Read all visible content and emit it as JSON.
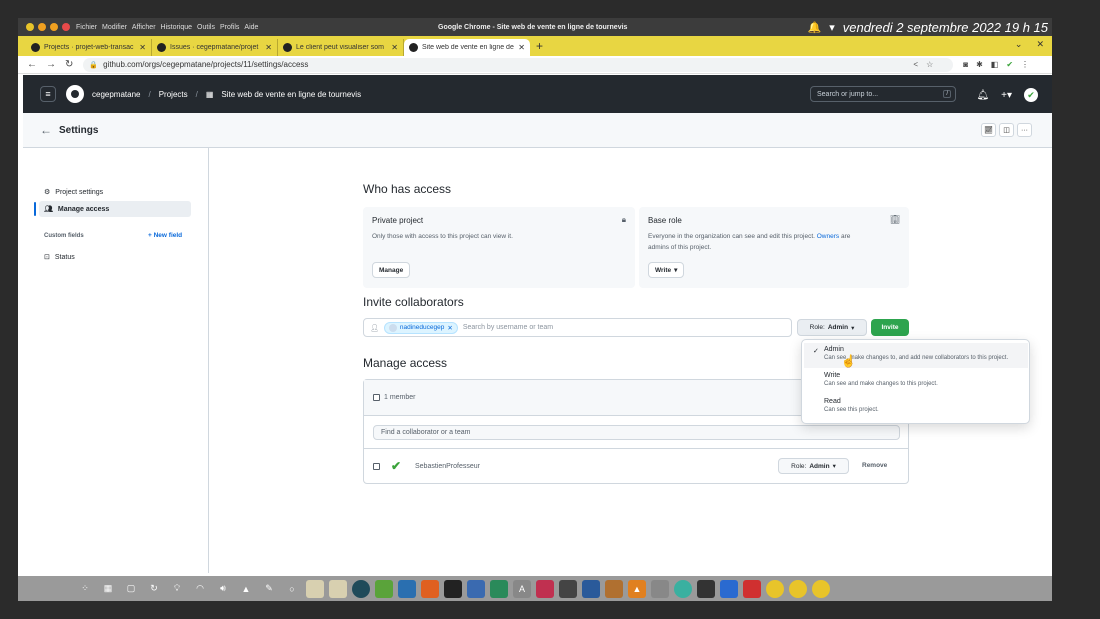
{
  "os": {
    "menus": [
      "Fichier",
      "Modifier",
      "Afficher",
      "Historique",
      "Outils",
      "Profils",
      "Aide"
    ],
    "window_title": "Google Chrome - Site web de vente en ligne de tournevis",
    "datetime": "vendredi 2 septembre 2022  19 h 15",
    "dot_colors": [
      "#e8c42a",
      "#f0a020",
      "#e84a4a"
    ]
  },
  "browser": {
    "tabs": [
      {
        "label": "Projects · projet-web-transac"
      },
      {
        "label": "Issues · cegepmatane/projet"
      },
      {
        "label": "Le client peut visualiser som"
      },
      {
        "label": "Site web de vente en ligne de"
      }
    ],
    "new_tab": "+",
    "url": "github.com/orgs/cegepmatane/projects/11/settings/access"
  },
  "github": {
    "org": "cegepmatane",
    "projects": "Projects",
    "project_name": "Site web de vente en ligne de tournevis",
    "search_placeholder": "Search or jump to...",
    "search_key": "/"
  },
  "settings": {
    "title": "Settings"
  },
  "sidebar": {
    "items": [
      {
        "label": "Project settings",
        "icon": "gear-icon"
      },
      {
        "label": "Manage access",
        "icon": "people-icon"
      }
    ],
    "custom_fields_heading": "Custom fields",
    "new_field": "New field",
    "fields": [
      {
        "label": "Status",
        "icon": "single-select-icon"
      }
    ]
  },
  "who_has_access": {
    "heading": "Who has access",
    "private": {
      "title": "Private project",
      "desc": "Only those with access to this project can view it.",
      "button": "Manage"
    },
    "base_role": {
      "title": "Base role",
      "desc_before": "Everyone in the organization can see and edit this project.",
      "desc_link": "Owners",
      "desc_after": "are",
      "desc_line2": "admins of this project.",
      "button": "Write"
    }
  },
  "invite": {
    "heading": "Invite collaborators",
    "chip": "nadineducegep",
    "placeholder": "Search by username or team",
    "role_label": "Role:",
    "role_value": "Admin",
    "invite_button": "Invite"
  },
  "manage_access": {
    "heading": "Manage access",
    "member_count": "1 member",
    "filter_placeholder": "Find a collaborator or a team",
    "members": [
      {
        "name": "SebastienProfesseur",
        "role_label": "Role:",
        "role_value": "Admin",
        "remove": "Remove"
      }
    ]
  },
  "role_dropdown": {
    "options": [
      {
        "title": "Admin",
        "desc": "Can see, make changes to, and add new collaborators to this project.",
        "selected": true
      },
      {
        "title": "Write",
        "desc": "Can see and make changes to this project.",
        "selected": false
      },
      {
        "title": "Read",
        "desc": "Can see this project.",
        "selected": false
      }
    ]
  },
  "colors": {
    "accent": "#0969da",
    "invite_green": "#2da44e",
    "header_dark": "#24292f",
    "tabstrip_yellow": "#e8d642"
  }
}
